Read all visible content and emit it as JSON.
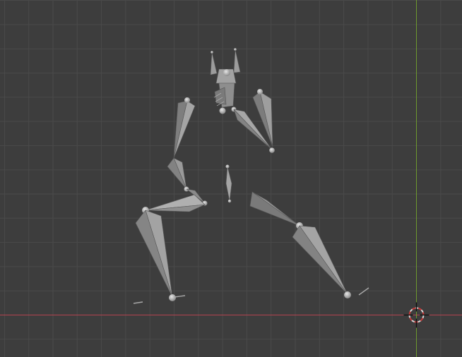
{
  "viewport": {
    "view": "3d-viewport-front-orthographic",
    "background_color": "#3d3d3d",
    "grid_color": "#4a4a4a",
    "x_axis_color": "#b5434f",
    "z_axis_color": "#6e9a2e",
    "bone_color": "#8c8c8c"
  },
  "armature": {
    "bone_count": 15,
    "mode": "object",
    "selected": false
  },
  "cursor_3d": {
    "icon": "3d-cursor-crosshair-icon"
  }
}
